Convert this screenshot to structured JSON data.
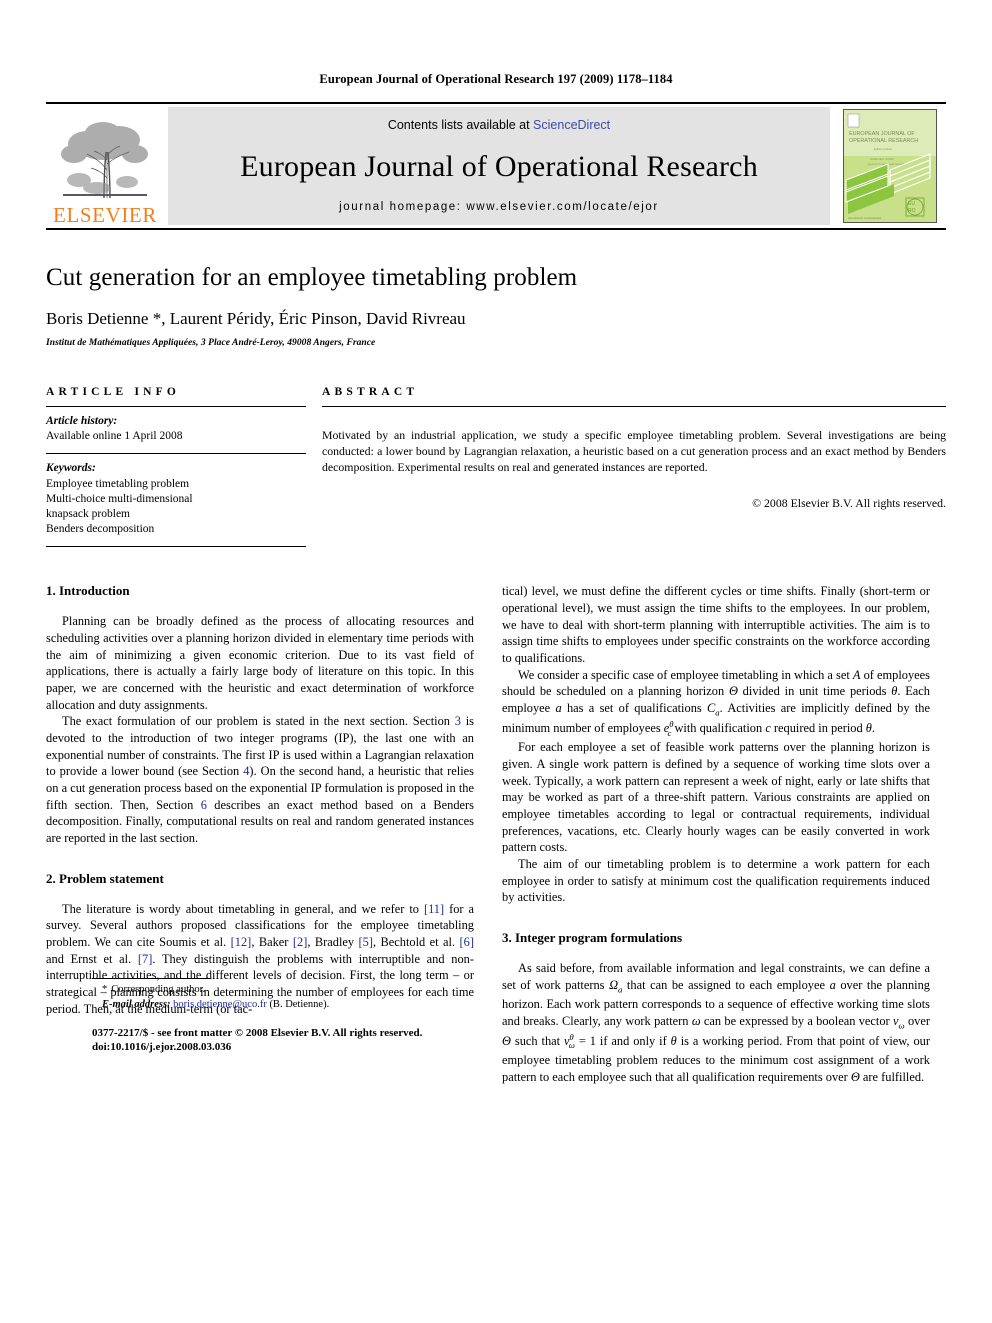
{
  "running_head": "European Journal of Operational Research 197 (2009) 1178–1184",
  "masthead": {
    "publisher_name": "ELSEVIER",
    "contents_prefix": "Contents lists available at ",
    "sciencedirect": "ScienceDirect",
    "journal_title": "European Journal of Operational Research",
    "homepage": "journal homepage: www.elsevier.com/locate/ejor",
    "cover_title_line1": "EUROPEAN JOURNAL OF",
    "cover_title_line2": "OPERATIONAL RESEARCH",
    "cover_logo_text": "EURO",
    "accent_color": "#F07F1A",
    "link_color": "#3b4ba8",
    "band_color": "#e3e3e3",
    "cover_green": "#b4d44e"
  },
  "article": {
    "title": "Cut generation for an employee timetabling problem",
    "authors": "Boris Detienne *, Laurent Péridy, Éric Pinson, David Rivreau",
    "affiliation": "Institut de Mathématiques Appliquées, 3 Place André-Leroy, 49008 Angers, France"
  },
  "article_info": {
    "heading": "ARTICLE INFO",
    "history_label": "Article history:",
    "history_value": "Available online 1 April 2008",
    "keywords_label": "Keywords:",
    "keywords": [
      "Employee timetabling problem",
      "Multi-choice multi-dimensional",
      "knapsack problem",
      "Benders decomposition"
    ]
  },
  "abstract": {
    "heading": "ABSTRACT",
    "text": "Motivated by an industrial application, we study a specific employee timetabling problem. Several investigations are being conducted: a lower bound by Lagrangian relaxation, a heuristic based on a cut generation process and an exact method by Benders decomposition. Experimental results on real and generated instances are reported.",
    "copyright": "© 2008 Elsevier B.V. All rights reserved."
  },
  "sections": {
    "introduction_heading": "1. Introduction",
    "intro_p1": "Planning can be broadly defined as the process of allocating resources and scheduling activities over a planning horizon divided in elementary time periods with the aim of minimizing a given economic criterion. Due to its vast field of applications, there is actually a fairly large body of literature on this topic. In this paper, we are concerned with the heuristic and exact determination of workforce allocation and duty assignments.",
    "intro_p2_a": "The exact formulation of our problem is stated in the next section. Section ",
    "intro_p2_ref3": "3",
    "intro_p2_b": " is devoted to the introduction of two integer programs (IP), the last one with an exponential number of constraints. The first IP is used within a Lagrangian relaxation to provide a lower bound (see Section ",
    "intro_p2_ref4": "4",
    "intro_p2_c": "). On the second hand, a heuristic that relies on a cut generation process based on the exponential IP formulation is proposed in the fifth section. Then, Section ",
    "intro_p2_ref6": "6",
    "intro_p2_d": " describes an exact method based on a Benders decomposition. Finally, computational results on real and random generated instances are reported in the last section.",
    "problem_heading": "2. Problem statement",
    "problem_p1_a": "The literature is wordy about timetabling in general, and we refer to ",
    "problem_ref11": "[11]",
    "problem_p1_b": " for a survey. Several authors proposed classifications for the employee timetabling problem. We can cite Soumis et al. ",
    "problem_ref12": "[12]",
    "problem_p1_c": ", Baker ",
    "problem_ref2": "[2]",
    "problem_p1_d": ", Bradley ",
    "problem_ref5": "[5]",
    "problem_p1_e": ", Bechtold et al. ",
    "problem_ref6": "[6]",
    "problem_p1_f": " and Ernst et al. ",
    "problem_ref7": "[7]",
    "problem_p1_g": ". They distinguish the problems with interruptible and non-interruptible activities, and the different levels of decision. First, the long term – or strategical – planning consists in determining the number of employees for each time period. Then, at the medium-term (or tac-",
    "right_p1": "tical) level, we must define the different cycles or time shifts. Finally (short-term or operational level), we must assign the time shifts to the employees. In our problem, we have to deal with short-term planning with interruptible activities. The aim is to assign time shifts to employees under specific constraints on the workforce according to qualifications.",
    "right_p2_a": "We consider a specific case of employee timetabling in which a set ",
    "right_p2_A": "A",
    "right_p2_b": " of employees should be scheduled on a planning horizon ",
    "right_p2_Theta": "Θ",
    "right_p2_c": " divided in unit time periods ",
    "right_p2_theta": "θ",
    "right_p2_d": ". Each employee ",
    "right_p2_a_var": "a",
    "right_p2_e": " has a set of qualifications ",
    "right_p2_Ca": "C",
    "right_p2_Ca_sub": "a",
    "right_p2_f": ". Activities are implicitly defined by the minimum number of employees ",
    "right_p2_e_var": "e",
    "right_p2_e_sub": "c",
    "right_p2_e_sup": "θ",
    "right_p2_g": " with qualification ",
    "right_p2_c_var": "c",
    "right_p2_h": " required in period ",
    "right_p2_theta2": "θ",
    "right_p2_i": ".",
    "right_p3": "For each employee a set of feasible work patterns over the planning horizon is given. A single work pattern is defined by a sequence of working time slots over a week. Typically, a work pattern can represent a week of night, early or late shifts that may be worked as part of a three-shift pattern. Various constraints are applied on employee timetables according to legal or contractual requirements, individual preferences, vacations, etc. Clearly hourly wages can be easily converted in work pattern costs.",
    "right_p4": "The aim of our timetabling problem is to determine a work pattern for each employee in order to satisfy at minimum cost the qualification requirements induced by activities.",
    "formulations_heading": "3. Integer program formulations",
    "right_p5_a": "As said before, from available information and legal constraints, we can define a set of work patterns ",
    "right_p5_Omega": "Ω",
    "right_p5_Omega_sub": "a",
    "right_p5_b": " that can be assigned to each employee ",
    "right_p5_a_var": "a",
    "right_p5_c": " over the planning horizon. Each work pattern corresponds to a sequence of effective working time slots and breaks. Clearly, any work pattern ",
    "right_p5_omega": "ω",
    "right_p5_d": " can be expressed by a boolean vector ",
    "right_p5_v": "v",
    "right_p5_v_sub": "ω",
    "right_p5_e": " over ",
    "right_p5_Theta": "Θ",
    "right_p5_f": " such that ",
    "right_p5_v2": "v",
    "right_p5_v2_sub": "ω",
    "right_p5_v2_sup": "θ",
    "right_p5_g": " = 1 if and only if ",
    "right_p5_theta": "θ",
    "right_p5_h": " is a working period. From that point of view, our employee timetabling problem reduces to the minimum cost assignment of a work pattern to each employee such that all qualification requirements over ",
    "right_p5_Theta2": "Θ",
    "right_p5_i": " are fulfilled."
  },
  "footnote": {
    "corresponding_marker": "*",
    "corresponding_text": "Corresponding author.",
    "email_label": "E-mail address:",
    "email": "boris.detienne@uco.fr",
    "email_suffix": "(B. Detienne).",
    "issn_line": "0377-2217/$ - see front matter © 2008 Elsevier B.V. All rights reserved.",
    "doi_line": "doi:10.1016/j.ejor.2008.03.036"
  }
}
